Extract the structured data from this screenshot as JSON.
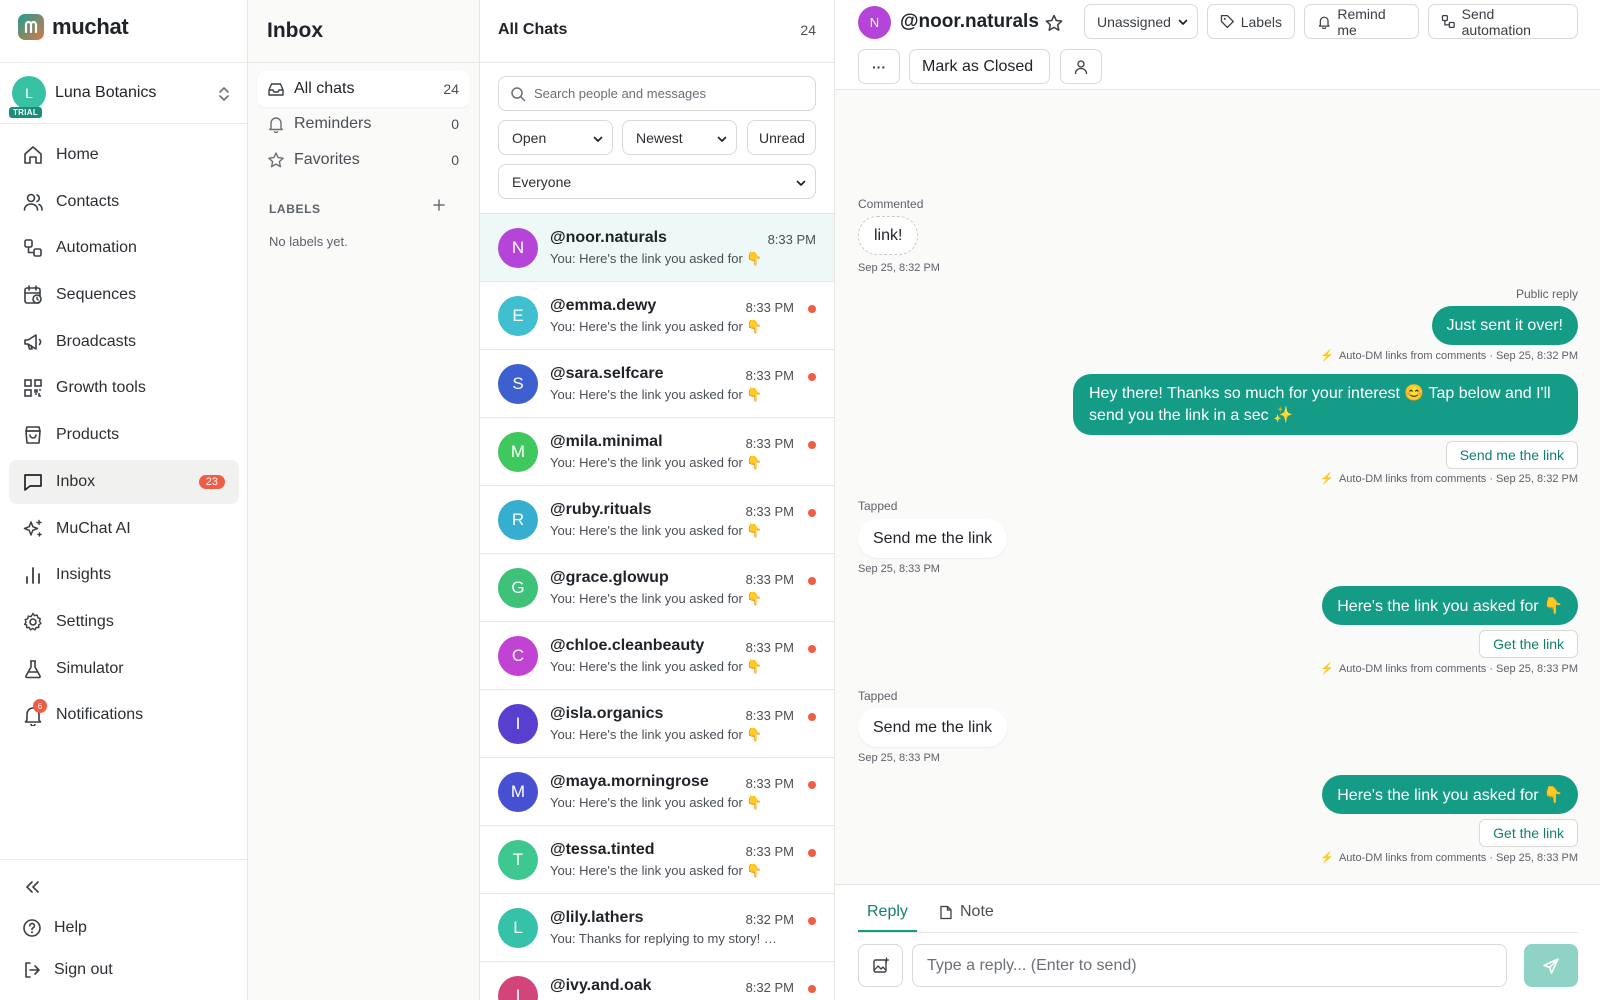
{
  "brand": {
    "name": "muchat"
  },
  "workspace": {
    "initial": "L",
    "badge": "TRIAL",
    "name": "Luna Botanics"
  },
  "nav": {
    "items": [
      {
        "label": "Home",
        "icon": "home-icon"
      },
      {
        "label": "Contacts",
        "icon": "users-icon"
      },
      {
        "label": "Automation",
        "icon": "automation-icon"
      },
      {
        "label": "Sequences",
        "icon": "calendar-clock-icon"
      },
      {
        "label": "Broadcasts",
        "icon": "megaphone-icon"
      },
      {
        "label": "Growth tools",
        "icon": "qr-code-icon"
      },
      {
        "label": "Products",
        "icon": "shopping-bag-icon"
      },
      {
        "label": "Inbox",
        "icon": "message-square-icon",
        "badge": "23"
      },
      {
        "label": "MuChat AI",
        "icon": "sparkles-icon"
      },
      {
        "label": "Insights",
        "icon": "bar-chart-icon"
      },
      {
        "label": "Settings",
        "icon": "gear-icon"
      },
      {
        "label": "Simulator",
        "icon": "flask-icon"
      },
      {
        "label": "Notifications",
        "icon": "bell-icon",
        "badge": "6"
      }
    ],
    "help": "Help",
    "sign_out": "Sign out"
  },
  "inbox": {
    "title": "Inbox",
    "folders": [
      {
        "label": "All chats",
        "count": "24"
      },
      {
        "label": "Reminders",
        "count": "0"
      },
      {
        "label": "Favorites",
        "count": "0"
      }
    ],
    "labels_heading": "LABELS",
    "labels_empty": "No labels yet."
  },
  "chatlist": {
    "title": "All Chats",
    "count": "24",
    "search_placeholder": "Search people and messages",
    "filter_status": "Open",
    "filter_sort": "Newest",
    "unread_label": "Unread",
    "filter_assignee": "Everyone",
    "rows": [
      {
        "initial": "N",
        "name": "@noor.naturals",
        "time": "8:33 PM",
        "preview": "You: Here's the link you asked for 👇",
        "color": "#b445d8",
        "unread": false
      },
      {
        "initial": "E",
        "name": "@emma.dewy",
        "time": "8:33 PM",
        "preview": "You: Here's the link you asked for 👇",
        "color": "#3fbfcf",
        "unread": true
      },
      {
        "initial": "S",
        "name": "@sara.selfcare",
        "time": "8:33 PM",
        "preview": "You: Here's the link you asked for 👇",
        "color": "#3e5fcf",
        "unread": true
      },
      {
        "initial": "M",
        "name": "@mila.minimal",
        "time": "8:33 PM",
        "preview": "You: Here's the link you asked for 👇",
        "color": "#3ec85e",
        "unread": true
      },
      {
        "initial": "R",
        "name": "@ruby.rituals",
        "time": "8:33 PM",
        "preview": "You: Here's the link you asked for 👇",
        "color": "#36aecf",
        "unread": true
      },
      {
        "initial": "G",
        "name": "@grace.glowup",
        "time": "8:33 PM",
        "preview": "You: Here's the link you asked for 👇",
        "color": "#3ec27a",
        "unread": true
      },
      {
        "initial": "C",
        "name": "@chloe.cleanbeauty",
        "time": "8:33 PM",
        "preview": "You: Here's the link you asked for 👇",
        "color": "#c142d3",
        "unread": true
      },
      {
        "initial": "I",
        "name": "@isla.organics",
        "time": "8:33 PM",
        "preview": "You: Here's the link you asked for 👇",
        "color": "#5a3ecf",
        "unread": true
      },
      {
        "initial": "M",
        "name": "@maya.morningrose",
        "time": "8:33 PM",
        "preview": "You: Here's the link you asked for 👇",
        "color": "#4650d0",
        "unread": true
      },
      {
        "initial": "T",
        "name": "@tessa.tinted",
        "time": "8:33 PM",
        "preview": "You: Here's the link you asked for 👇",
        "color": "#3ec88f",
        "unread": true
      },
      {
        "initial": "L",
        "name": "@lily.lathers",
        "time": "8:32 PM",
        "preview": "You: Thanks for replying to my story! …",
        "color": "#36c2a8",
        "unread": true
      },
      {
        "initial": "I",
        "name": "@ivy.and.oak",
        "time": "8:32 PM",
        "preview": "",
        "color": "#d2457a",
        "unread": true
      }
    ]
  },
  "conversation": {
    "initial": "N",
    "name": "@noor.naturals",
    "assign_label": "Unassigned",
    "labels_label": "Labels",
    "remind_label": "Remind me",
    "automation_label": "Send automation",
    "more_label": "···",
    "close_label": "Mark as Closed",
    "messages": {
      "commented_label": "Commented",
      "comment_text": "link!",
      "comment_time": "Sep 25, 8:32 PM",
      "public_reply_label": "Public reply",
      "public_reply_text": "Just sent it over!",
      "auto_meta_1": "Auto-DM links from comments · Sep 25, 8:32 PM",
      "dm_text": "Hey there! Thanks so much for your interest 😊  Tap below and I'll send you the link in a sec ✨",
      "dm_button": "Send me the link",
      "auto_meta_2": "Auto-DM links from comments · Sep 25, 8:32 PM",
      "tapped_label_1": "Tapped",
      "tapped_text_1": "Send me the link",
      "tapped_time_1": "Sep 25, 8:33 PM",
      "link_text_1": "Here's the link you asked for 👇",
      "link_button_1": "Get the link",
      "auto_meta_3": "Auto-DM links from comments · Sep 25, 8:33 PM",
      "tapped_label_2": "Tapped",
      "tapped_text_2": "Send me the link",
      "tapped_time_2": "Sep 25, 8:33 PM",
      "link_text_2": "Here's the link you asked for 👇",
      "link_button_2": "Get the link",
      "auto_meta_4": "Auto-DM links from comments · Sep 25, 8:33 PM",
      "bolt_icon": "⚡"
    },
    "composer": {
      "reply_tab": "Reply",
      "note_tab": "Note",
      "placeholder": "Type a reply... (Enter to send)"
    }
  },
  "colors": {
    "accent": "#149c86",
    "unread_dot": "#ef5d43",
    "badge": "#ef5d43"
  }
}
